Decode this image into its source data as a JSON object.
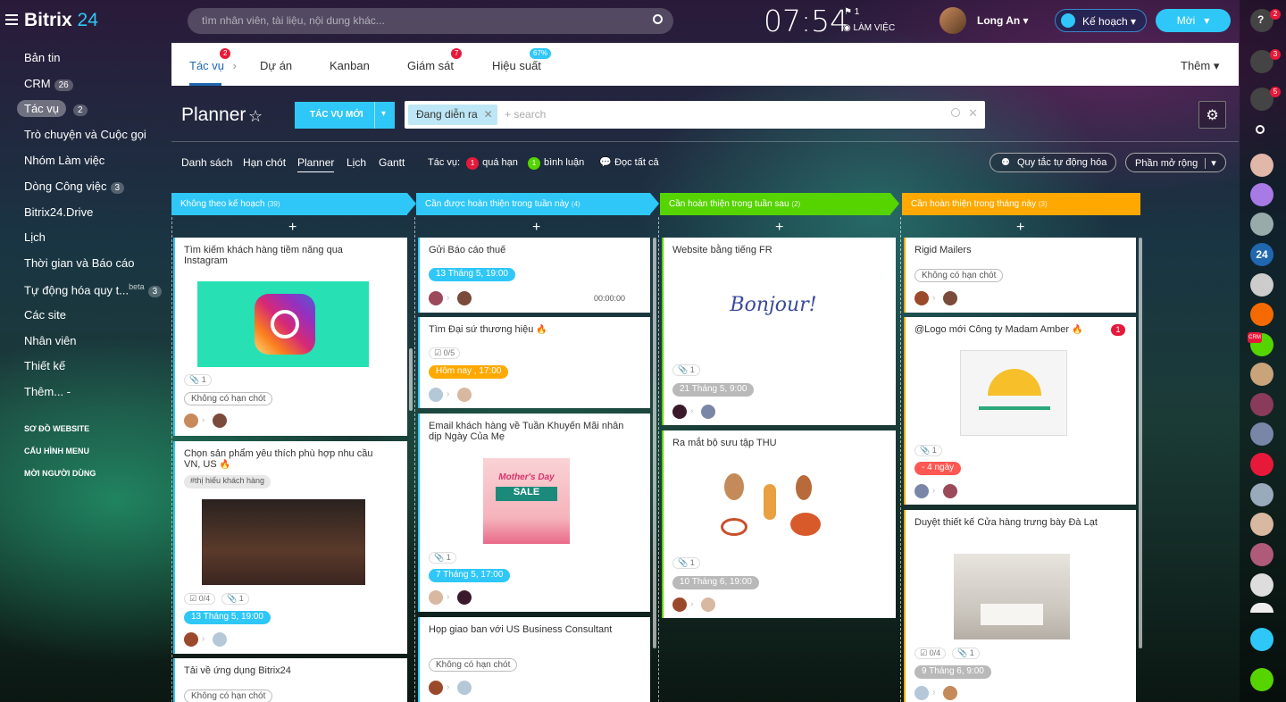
{
  "app": {
    "name_part1": "Bitrix",
    "name_part2": "24"
  },
  "search": {
    "placeholder": "tìm nhân viên, tài liệu, nội dung khác..."
  },
  "clock": {
    "time": "07:54",
    "flag_count": "1",
    "status": "LÀM VIỆC"
  },
  "user": {
    "name": "Long An"
  },
  "buttons": {
    "plan": "Kế hoạch",
    "new": "Mời",
    "new_task": "TÁC VỤ MỚI"
  },
  "sidebar": {
    "items": [
      {
        "label": "Bản tin",
        "count": ""
      },
      {
        "label": "CRM",
        "count": "26"
      },
      {
        "label": "Tác vụ",
        "count": "2"
      },
      {
        "label": "Trò chuyện và Cuộc gọi",
        "count": ""
      },
      {
        "label": "Nhóm Làm việc",
        "count": ""
      },
      {
        "label": "Dòng Công việc",
        "count": "3"
      },
      {
        "label": "Bitrix24.Drive",
        "count": ""
      },
      {
        "label": "Lịch",
        "count": ""
      },
      {
        "label": "Thời gian và Báo cáo",
        "count": ""
      },
      {
        "label": "Tự động hóa quy t...",
        "count": "3",
        "beta": "beta"
      },
      {
        "label": "Các site",
        "count": ""
      },
      {
        "label": "Nhân viên",
        "count": ""
      },
      {
        "label": "Thiết kế",
        "count": ""
      },
      {
        "label": "Thêm...",
        "count": ""
      }
    ],
    "links": [
      "SƠ ĐỒ WEBSITE",
      "CẤU HÌNH MENU",
      "MỜI NGƯỜI DÙNG"
    ]
  },
  "tabs": [
    {
      "label": "Tác vụ",
      "badge": "2"
    },
    {
      "label": "Dự án",
      "badge": ""
    },
    {
      "label": "Kanban",
      "badge": ""
    },
    {
      "label": "Giám sát",
      "badge": "7"
    },
    {
      "label": "Hiệu suất",
      "badge": "67%"
    },
    {
      "label": "Thêm",
      "badge": ""
    }
  ],
  "page": {
    "title": "Planner"
  },
  "filter": {
    "chip": "Đang diễn ra",
    "placeholder": "+ search"
  },
  "views": [
    "Danh sách",
    "Hạn chót",
    "Planner",
    "Lịch",
    "Gantt"
  ],
  "counters": {
    "label": "Tác vụ:",
    "overdue_count": "1",
    "overdue_label": "quá hạn",
    "comments_count": "1",
    "comments_label": "bình luận",
    "read_all": "Đọc tất cả"
  },
  "right_buttons": {
    "automation": "Quy tắc tự động hóa",
    "extensions": "Phần mở rộng"
  },
  "rail_badges": {
    "help": "2",
    "notifications": "3",
    "chat": "5",
    "crm": "CRM"
  },
  "columns": [
    {
      "title": "Không theo kế hoạch",
      "count": "(39)",
      "color": "#2fc7f7"
    },
    {
      "title": "Cần được hoàn thiện trong tuần này",
      "count": "(4)",
      "color": "#2fc7f7"
    },
    {
      "title": "Cần hoàn thiện trong tuần sau",
      "count": "(2)",
      "color": "#55d400"
    },
    {
      "title": "Cần hoàn thiện trong tháng này",
      "count": "(3)",
      "color": "#ffa900"
    }
  ],
  "cards": {
    "c1": {
      "title": "Tìm kiếm khách hàng tiềm năng qua Instagram",
      "files": "1",
      "tag": "Không có hạn chót"
    },
    "c2": {
      "title": "Chọn sản phẩm yêu thích phù hợp nhu cầu VN, US",
      "hashtag": "#thị hiếu khách hàng",
      "checklist": "0/4",
      "files": "1",
      "deadline": "13 Tháng 5, 19:00"
    },
    "c3": {
      "title": "Tải về ứng dụng Bitrix24",
      "tag": "Không có hạn chót"
    },
    "c4": {
      "title": "Gửi Báo cáo thuế",
      "deadline": "13 Tháng 5, 19:00",
      "timer": "00:00:00"
    },
    "c5": {
      "title": "Tìm Đại sứ thương hiệu",
      "checklist": "0/5",
      "deadline": "Hôm nay , 17:00"
    },
    "c6": {
      "title": "Email khách hàng về Tuần Khuyến Mãi nhân dịp Ngày Của Mẹ",
      "files": "1",
      "deadline": "7 Tháng 5, 17:00",
      "img_line1": "Mother's Day",
      "img_line2": "SALE"
    },
    "c7": {
      "title": "Họp giao ban với US Business Consultant",
      "tag": "Không có hạn chót"
    },
    "c8": {
      "title": "Website bằng tiếng FR",
      "files": "1",
      "deadline": "21 Tháng 5, 9:00",
      "img_text": "Bonjour!"
    },
    "c9": {
      "title": "Ra mắt bộ sưu tập THU",
      "files": "1",
      "deadline": "10 Tháng 6, 19:00"
    },
    "c10": {
      "title": "Rigid Mailers",
      "tag": "Không có hạn chót"
    },
    "c11": {
      "title": "@Logo mới Công ty Madam Amber",
      "badge": "1",
      "files": "1",
      "deadline": "- 4 ngày"
    },
    "c12": {
      "title": "Duyệt thiết kế Cửa hàng trưng bày Đà Lạt",
      "checklist": "0/4",
      "files": "1",
      "deadline": "9 Tháng 6, 9:00"
    }
  },
  "colors": {
    "accent": "#2fc7f7",
    "orange": "#ffa900",
    "green": "#55d400",
    "gray": "#b9b9b9",
    "red": "#ff5752"
  }
}
